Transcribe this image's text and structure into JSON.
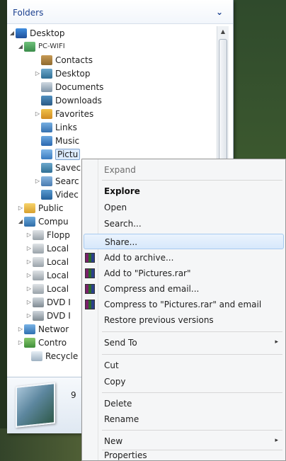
{
  "folders": {
    "title": "Folders",
    "chevron": "chevron-down-icon"
  },
  "tree": [
    {
      "label": "Desktop",
      "icon": "desktop-icon",
      "arrow": "expanded"
    },
    {
      "label": "PC-WIFI",
      "icon": "user-folder-icon",
      "arrow": "expanded"
    },
    {
      "label": "Contacts",
      "icon": "contacts-icon",
      "arrow": ""
    },
    {
      "label": "Desktop",
      "icon": "folder-icon",
      "arrow": "collapsed"
    },
    {
      "label": "Documents",
      "icon": "documents-icon",
      "arrow": ""
    },
    {
      "label": "Downloads",
      "icon": "downloads-icon",
      "arrow": ""
    },
    {
      "label": "Favorites",
      "icon": "favorites-icon",
      "arrow": "collapsed"
    },
    {
      "label": "Links",
      "icon": "links-icon",
      "arrow": ""
    },
    {
      "label": "Music",
      "icon": "music-icon",
      "arrow": ""
    },
    {
      "label": "Pictu",
      "icon": "pictures-icon",
      "arrow": ""
    },
    {
      "label": "Savec",
      "icon": "saved-games-icon",
      "arrow": ""
    },
    {
      "label": "Searc",
      "icon": "searches-icon",
      "arrow": "collapsed"
    },
    {
      "label": "Videc",
      "icon": "videos-icon",
      "arrow": ""
    },
    {
      "label": "Public",
      "icon": "public-folder-icon",
      "arrow": "collapsed"
    },
    {
      "label": "Compu",
      "icon": "computer-icon",
      "arrow": "expanded"
    },
    {
      "label": "Flopp",
      "icon": "floppy-icon",
      "arrow": "collapsed"
    },
    {
      "label": "Local",
      "icon": "local-disk-icon",
      "arrow": "collapsed"
    },
    {
      "label": "Local",
      "icon": "local-disk-icon",
      "arrow": "collapsed"
    },
    {
      "label": "Local",
      "icon": "local-disk-icon",
      "arrow": "collapsed"
    },
    {
      "label": "Local",
      "icon": "local-disk-icon",
      "arrow": "collapsed"
    },
    {
      "label": "DVD I",
      "icon": "dvd-drive-icon",
      "arrow": "collapsed"
    },
    {
      "label": "DVD I",
      "icon": "dvd-drive-icon",
      "arrow": "collapsed"
    },
    {
      "label": "Networ",
      "icon": "network-icon",
      "arrow": "collapsed"
    },
    {
      "label": "Contro",
      "icon": "control-panel-icon",
      "arrow": "collapsed"
    },
    {
      "label": "Recycle",
      "icon": "recycle-bin-icon",
      "arrow": ""
    }
  ],
  "details": {
    "count_text": "9"
  },
  "context_menu": {
    "items": [
      {
        "label": "Expand",
        "style": "disabled"
      },
      {
        "label": "Explore",
        "style": "bold"
      },
      {
        "label": "Open",
        "style": "normal"
      },
      {
        "label": "Search...",
        "style": "normal"
      },
      {
        "label": "Share...",
        "style": "highlight"
      },
      {
        "label": "Add to archive...",
        "icon": "winrar-icon"
      },
      {
        "label": "Add to \"Pictures.rar\"",
        "icon": "winrar-icon"
      },
      {
        "label": "Compress and email...",
        "icon": "winrar-icon"
      },
      {
        "label": "Compress to \"Pictures.rar\" and email",
        "icon": "winrar-icon"
      },
      {
        "label": "Restore previous versions",
        "style": "normal"
      },
      {
        "label": "Send To",
        "submenu": true
      },
      {
        "label": "Cut",
        "style": "normal"
      },
      {
        "label": "Copy",
        "style": "normal"
      },
      {
        "label": "Delete",
        "style": "normal"
      },
      {
        "label": "Rename",
        "style": "normal"
      },
      {
        "label": "New",
        "submenu": true
      },
      {
        "label": "Properties",
        "style": "normal"
      }
    ],
    "submenu_arrow": "▸"
  },
  "colors": {
    "header_text": "#1a3f8f",
    "menu_bg": "#f5f6f7",
    "highlight": "#d7e8fb"
  }
}
